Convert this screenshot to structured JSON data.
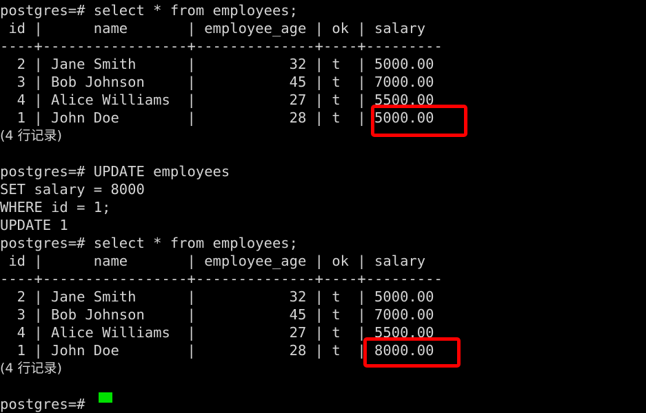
{
  "terminal": {
    "background_color": "#000000",
    "text_color": "#d4d4d4",
    "prompt": "postgres=#",
    "cursor_color": "#00e000",
    "annotation_color": "#ff0000"
  },
  "lines": [
    {
      "id": "l01",
      "text": "postgres=# select * from employees;"
    },
    {
      "id": "l02",
      "text": " id |      name       | employee_age | ok | salary"
    },
    {
      "id": "l03",
      "text": "----+-----------------+--------------+----+---------"
    },
    {
      "id": "l04",
      "text": "  2 | Jane Smith      |           32 | t  | 5000.00"
    },
    {
      "id": "l05",
      "text": "  3 | Bob Johnson     |           45 | t  | 7000.00"
    },
    {
      "id": "l06",
      "text": "  4 | Alice Williams  |           27 | t  | 5500.00"
    },
    {
      "id": "l07",
      "text": "  1 | John Doe        |           28 | t  | 5000.00"
    },
    {
      "id": "l08",
      "text": "(4 行记录)",
      "cjk": true
    },
    {
      "id": "l09",
      "text": ""
    },
    {
      "id": "l10",
      "text": "postgres=# UPDATE employees"
    },
    {
      "id": "l11",
      "text": "SET salary = 8000"
    },
    {
      "id": "l12",
      "text": "WHERE id = 1;"
    },
    {
      "id": "l13",
      "text": "UPDATE 1"
    },
    {
      "id": "l14",
      "text": "postgres=# select * from employees;"
    },
    {
      "id": "l15",
      "text": " id |      name       | employee_age | ok | salary"
    },
    {
      "id": "l16",
      "text": "----+-----------------+--------------+----+---------"
    },
    {
      "id": "l17",
      "text": "  2 | Jane Smith      |           32 | t  | 5000.00"
    },
    {
      "id": "l18",
      "text": "  3 | Bob Johnson     |           45 | t  | 7000.00"
    },
    {
      "id": "l19",
      "text": "  4 | Alice Williams  |           27 | t  | 5500.00"
    },
    {
      "id": "l20",
      "text": "  1 | John Doe        |           28 | t  | 8000.00"
    },
    {
      "id": "l21",
      "text": "(4 行记录)",
      "cjk": true
    },
    {
      "id": "l22",
      "text": ""
    },
    {
      "id": "l23",
      "text": "postgres=#"
    }
  ],
  "queries": {
    "select_statement": "select * from employees;",
    "update_statement_line_1": "UPDATE employees",
    "update_statement_line_2": "SET salary = 8000",
    "update_statement_line_3": "WHERE id = 1;",
    "update_result": "UPDATE 1"
  },
  "table_before": {
    "columns": [
      "id",
      "name",
      "employee_age",
      "ok",
      "salary"
    ],
    "rows": [
      {
        "id": "2",
        "name": "Jane Smith",
        "employee_age": "32",
        "ok": "t",
        "salary": "5000.00"
      },
      {
        "id": "3",
        "name": "Bob Johnson",
        "employee_age": "45",
        "ok": "t",
        "salary": "7000.00"
      },
      {
        "id": "4",
        "name": "Alice Williams",
        "employee_age": "27",
        "ok": "t",
        "salary": "5500.00"
      },
      {
        "id": "1",
        "name": "John Doe",
        "employee_age": "28",
        "ok": "t",
        "salary": "5000.00"
      }
    ],
    "row_count_text": "(4 行记录)"
  },
  "table_after": {
    "columns": [
      "id",
      "name",
      "employee_age",
      "ok",
      "salary"
    ],
    "rows": [
      {
        "id": "2",
        "name": "Jane Smith",
        "employee_age": "32",
        "ok": "t",
        "salary": "5000.00"
      },
      {
        "id": "3",
        "name": "Bob Johnson",
        "employee_age": "45",
        "ok": "t",
        "salary": "7000.00"
      },
      {
        "id": "4",
        "name": "Alice Williams",
        "employee_age": "27",
        "ok": "t",
        "salary": "5500.00"
      },
      {
        "id": "1",
        "name": "John Doe",
        "employee_age": "28",
        "ok": "t",
        "salary": "8000.00"
      }
    ],
    "row_count_text": "(4 行记录)"
  },
  "annotations": [
    {
      "id": "anno-box-1",
      "highlights": "5000.00",
      "color": "#ff0000"
    },
    {
      "id": "anno-box-2",
      "highlights": "8000.00",
      "color": "#ff0000"
    }
  ]
}
